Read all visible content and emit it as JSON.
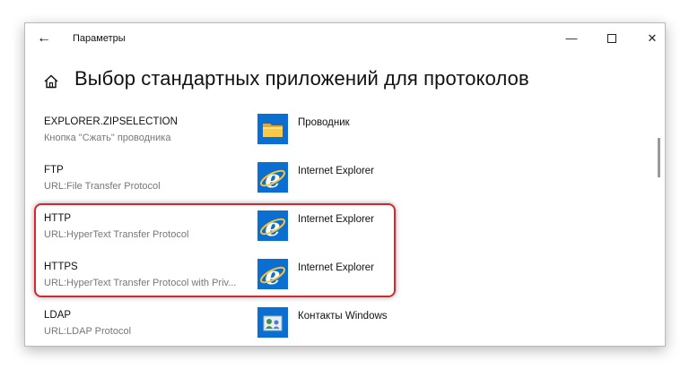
{
  "window": {
    "app_title": "Параметры",
    "back_label": "←",
    "minimize_label": "—",
    "close_label": "✕"
  },
  "header": {
    "title": "Выбор стандартных приложений для протоколов"
  },
  "protocols": [
    {
      "name": "EXPLORER.ZIPSELECTION",
      "description": "Кнопка \"Сжать\" проводника",
      "app": "Проводник",
      "app_icon": "file-explorer-icon"
    },
    {
      "name": "FTP",
      "description": "URL:File Transfer Protocol",
      "app": "Internet Explorer",
      "app_icon": "internet-explorer-icon"
    },
    {
      "name": "HTTP",
      "description": "URL:HyperText Transfer Protocol",
      "app": "Internet Explorer",
      "app_icon": "internet-explorer-icon"
    },
    {
      "name": "HTTPS",
      "description": "URL:HyperText Transfer Protocol with Priv...",
      "app": "Internet Explorer",
      "app_icon": "internet-explorer-icon"
    },
    {
      "name": "LDAP",
      "description": "URL:LDAP Protocol",
      "app": "Контакты Windows",
      "app_icon": "windows-contacts-icon"
    }
  ],
  "colors": {
    "tile_blue": "#0a6fd0",
    "highlight_red": "#d7262d",
    "folder_yellow": "#f8c94a",
    "ie_blue": "#1f77d4"
  }
}
